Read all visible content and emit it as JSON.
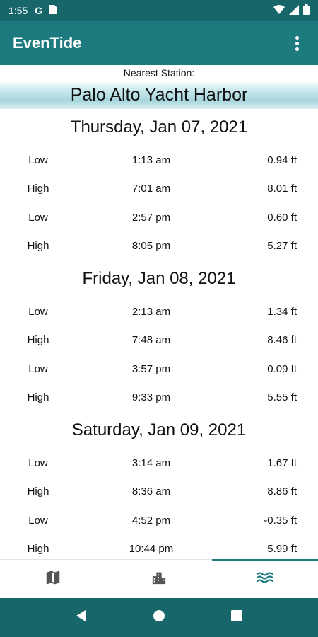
{
  "status_bar": {
    "time": "1:55",
    "g_glyph": "G",
    "icons": [
      "google-icon",
      "sim-card-icon",
      "wifi-icon",
      "signal-icon",
      "battery-icon"
    ]
  },
  "app_bar": {
    "title": "EvenTide",
    "icons": [
      "more-vert-icon"
    ]
  },
  "station": {
    "label": "Nearest Station:",
    "name": "Palo Alto Yacht Harbor"
  },
  "days": [
    {
      "date": "Thursday, Jan 07, 2021",
      "tides": [
        {
          "type": "Low",
          "time": "1:13 am",
          "height": "0.94 ft"
        },
        {
          "type": "High",
          "time": "7:01 am",
          "height": "8.01 ft"
        },
        {
          "type": "Low",
          "time": "2:57 pm",
          "height": "0.60 ft"
        },
        {
          "type": "High",
          "time": "8:05 pm",
          "height": "5.27 ft"
        }
      ]
    },
    {
      "date": "Friday, Jan 08, 2021",
      "tides": [
        {
          "type": "Low",
          "time": "2:13 am",
          "height": "1.34 ft"
        },
        {
          "type": "High",
          "time": "7:48 am",
          "height": "8.46 ft"
        },
        {
          "type": "Low",
          "time": "3:57 pm",
          "height": "0.09 ft"
        },
        {
          "type": "High",
          "time": "9:33 pm",
          "height": "5.55 ft"
        }
      ]
    },
    {
      "date": "Saturday, Jan 09, 2021",
      "tides": [
        {
          "type": "Low",
          "time": "3:14 am",
          "height": "1.67 ft"
        },
        {
          "type": "High",
          "time": "8:36 am",
          "height": "8.86 ft"
        },
        {
          "type": "Low",
          "time": "4:52 pm",
          "height": "-0.35 ft"
        },
        {
          "type": "High",
          "time": "10:44 pm",
          "height": "5.99 ft"
        }
      ]
    }
  ],
  "bottom_nav": {
    "tabs": [
      "map-icon",
      "city-icon",
      "waves-icon"
    ],
    "active": "waves-icon"
  },
  "system_nav": {
    "icons": [
      "back-icon",
      "home-icon",
      "recents-icon"
    ]
  },
  "colors": {
    "status_bar": "#17666a",
    "app_bar": "#1d7a7e",
    "accent": "#1d7a7e",
    "icon_gray": "#555555"
  }
}
